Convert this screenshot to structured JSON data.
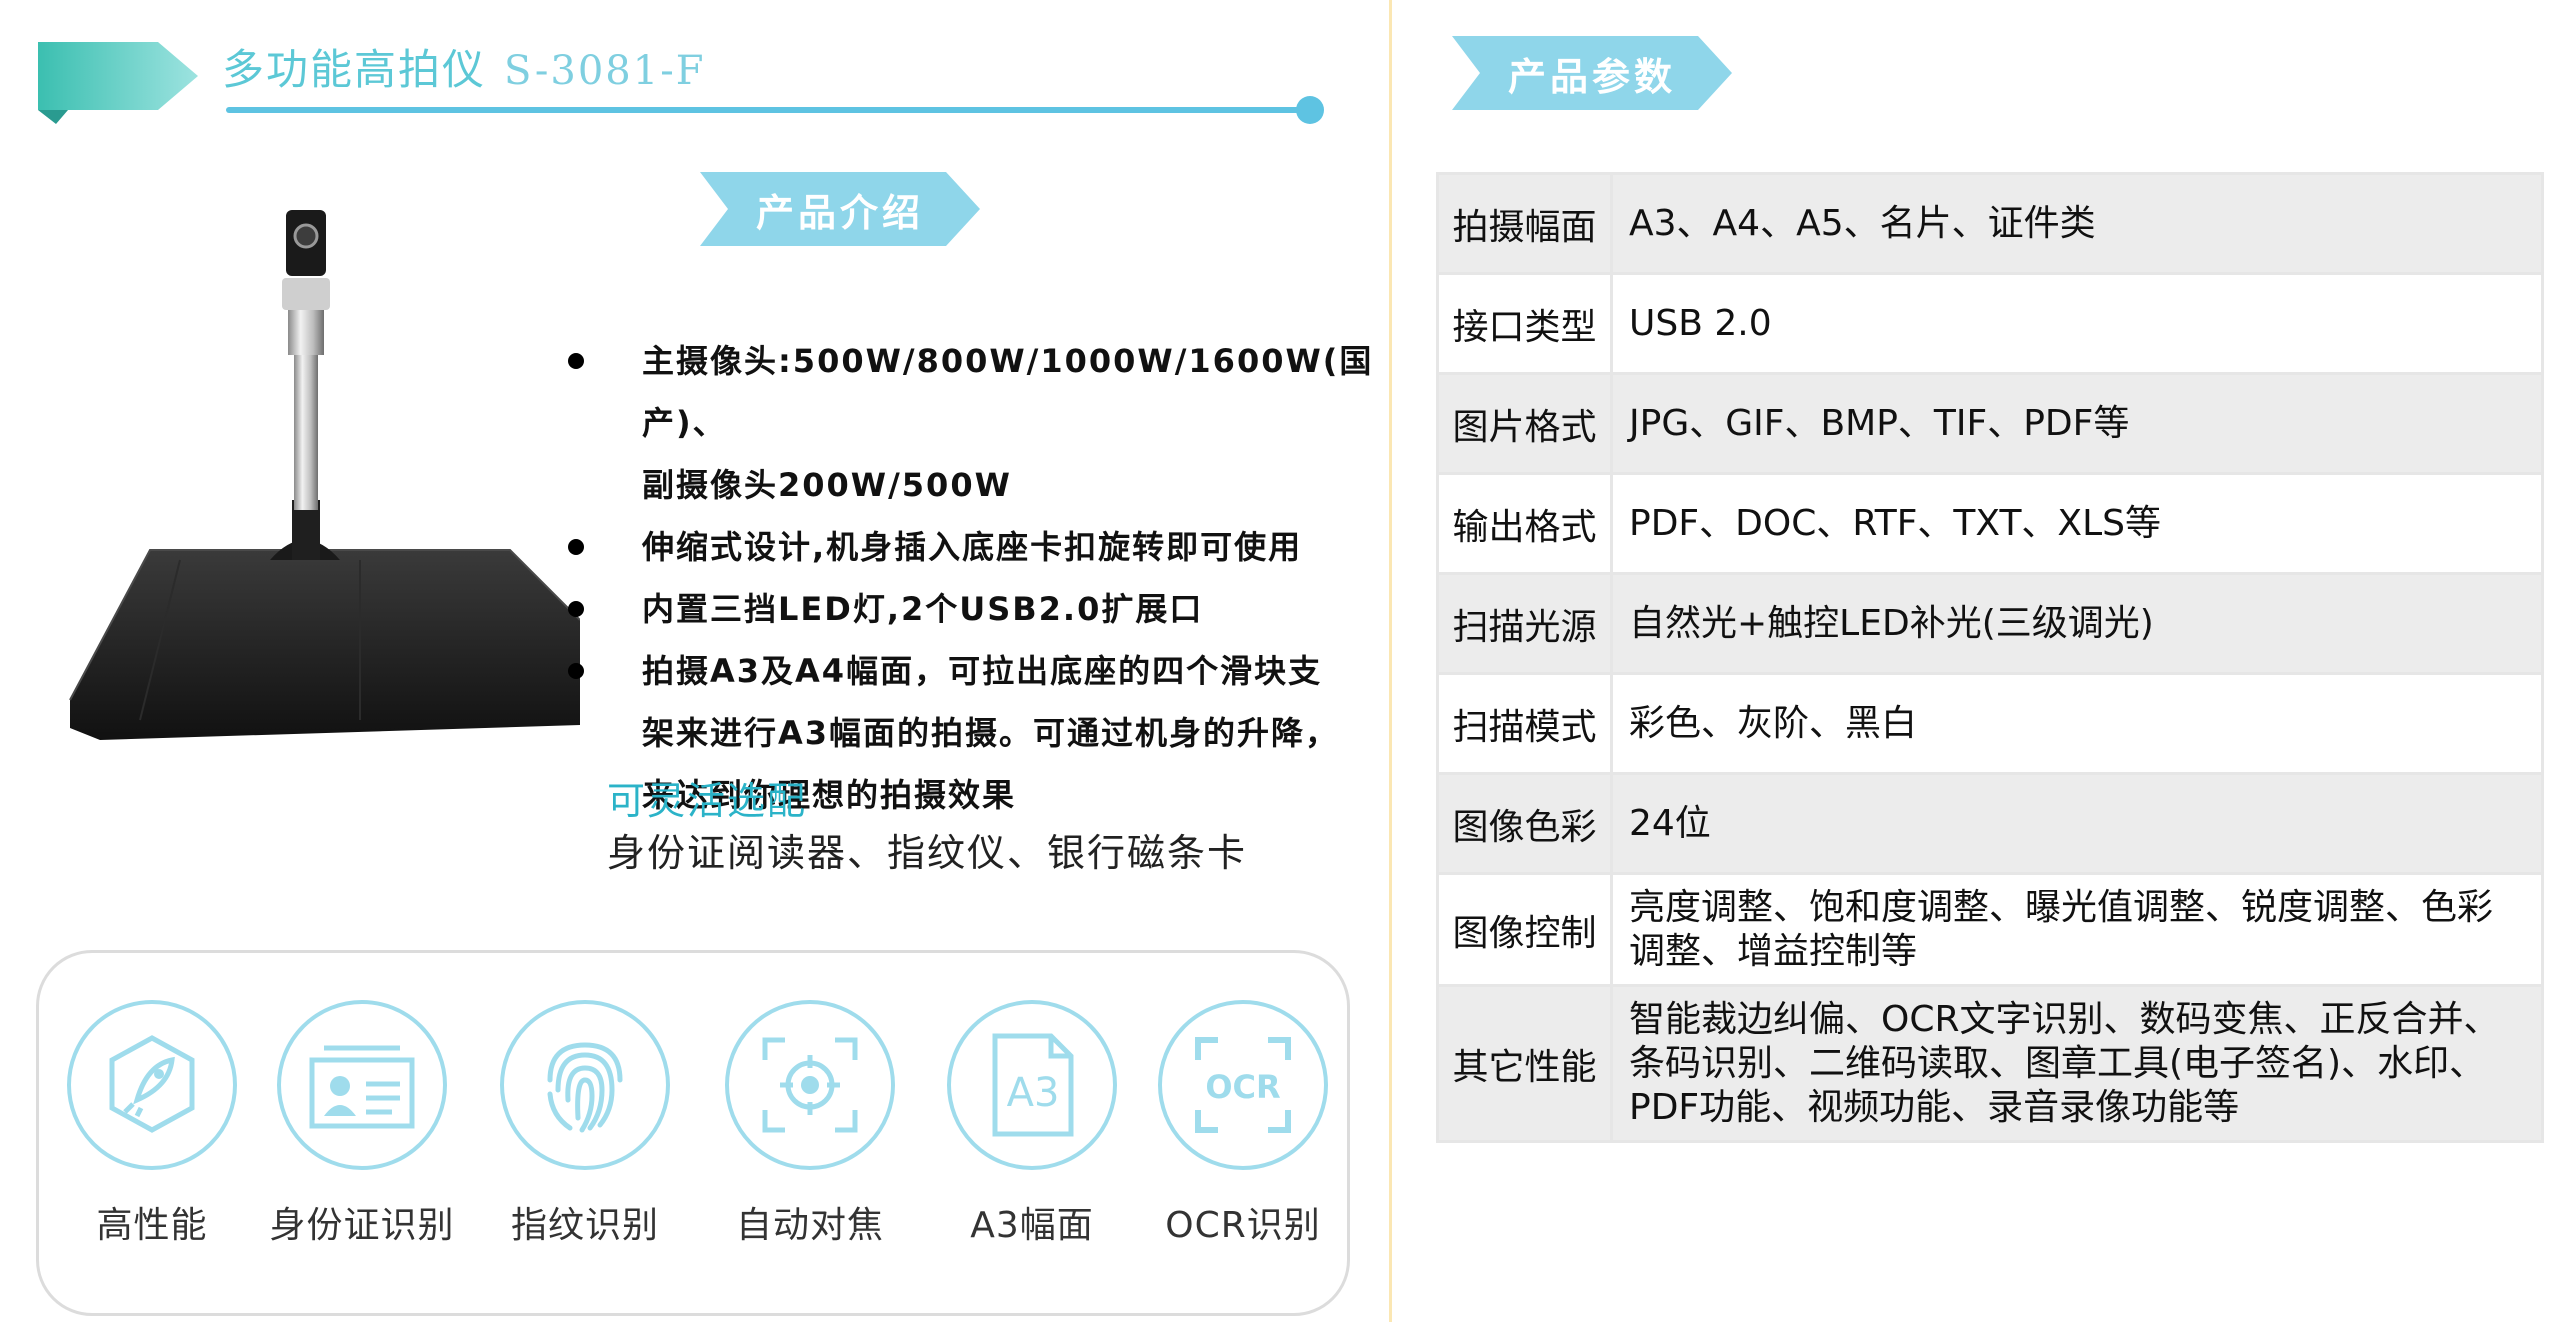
{
  "header": {
    "title": "多功能高拍仪",
    "model": "S-3081-F"
  },
  "sections": {
    "intro_tag": "产品介绍",
    "params_tag": "产品参数"
  },
  "features": [
    {
      "line1": "主摄像头:500W/800W/1000W/1600W(国产)、",
      "line2": "副摄像头200W/500W"
    },
    {
      "line1": "伸缩式设计,机身插入底座卡扣旋转即可使用",
      "line2": ""
    },
    {
      "line1": "内置三挡LED灯,2个USB2.0扩展口",
      "line2": ""
    },
    {
      "line1": "拍摄A3及A4幅面，可拉出底座的四个滑块支",
      "line2": "架来进行A3幅面的拍摄。可通过机身的升降，",
      "line3": "来达到你理想的拍摄效果"
    }
  ],
  "optional": {
    "title": "可灵活选配",
    "text": "身份证阅读器、指纹仪、银行磁条卡"
  },
  "icons": [
    {
      "label": "高性能",
      "icon": "rocket-icon"
    },
    {
      "label": "身份证识别",
      "icon": "id-card-icon"
    },
    {
      "label": "指纹识别",
      "icon": "fingerprint-icon"
    },
    {
      "label": "自动对焦",
      "icon": "focus-icon"
    },
    {
      "label": "A3幅面",
      "icon": "a3-document-icon",
      "glyph": "A3"
    },
    {
      "label": "OCR识别",
      "icon": "ocr-icon",
      "glyph": "OCR"
    }
  ],
  "specs": [
    {
      "key": "拍摄幅面",
      "value": "A3、A4、A5、名片、证件类"
    },
    {
      "key": "接口类型",
      "value": "USB 2.0"
    },
    {
      "key": "图片格式",
      "value": "JPG、GIF、BMP、TIF、PDF等"
    },
    {
      "key": "输出格式",
      "value": "PDF、DOC、RTF、TXT、XLS等"
    },
    {
      "key": "扫描光源",
      "value": "自然光+触控LED补光(三级调光)"
    },
    {
      "key": "扫描模式",
      "value": "彩色、灰阶、黑白"
    },
    {
      "key": "图像色彩",
      "value": "24位"
    },
    {
      "key": "图像控制",
      "value": "亮度调整、饱和度调整、曝光值调整、锐度调整、色彩调整、增益控制等"
    },
    {
      "key": "其它性能",
      "value": "智能裁边纠偏、OCR文字识别、数码变焦、正反合并、条码识别、二维码读取、图章工具(电子签名)、水印、PDF功能、视频功能、录音录像功能等"
    }
  ],
  "colors": {
    "accent": "#5ec3e2",
    "teal": "#2bb3c8",
    "tag": "#8fd6ea",
    "divider": "#fbe7b3"
  }
}
